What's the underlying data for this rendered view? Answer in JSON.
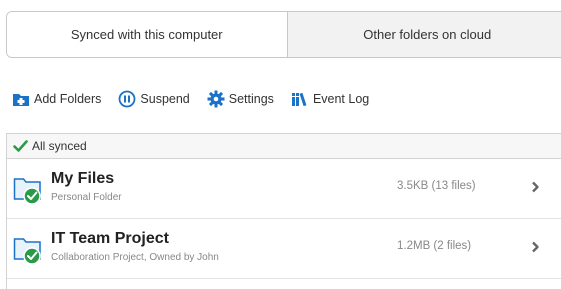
{
  "tabs": [
    {
      "label": "Synced with this computer",
      "active": true
    },
    {
      "label": "Other folders on cloud",
      "active": false
    }
  ],
  "toolbar": {
    "add_folders": {
      "label": "Add Folders",
      "icon": "add-folder-icon"
    },
    "suspend": {
      "label": "Suspend",
      "icon": "pause-circle-icon"
    },
    "settings": {
      "label": "Settings",
      "icon": "gear-icon"
    },
    "event_log": {
      "label": "Event Log",
      "icon": "books-icon"
    }
  },
  "status": {
    "label": "All synced",
    "icon": "checkmark-icon"
  },
  "folders": [
    {
      "name": "My Files",
      "subtitle": "Personal Folder",
      "size": "3.5KB (13 files)"
    },
    {
      "name": "IT Team Project",
      "subtitle": "Collaboration Project, Owned by John",
      "size": "1.2MB (2 files)"
    }
  ],
  "colors": {
    "accent": "#1a73c8",
    "synced_green": "#2a9a48",
    "border": "#c8c8c8"
  }
}
